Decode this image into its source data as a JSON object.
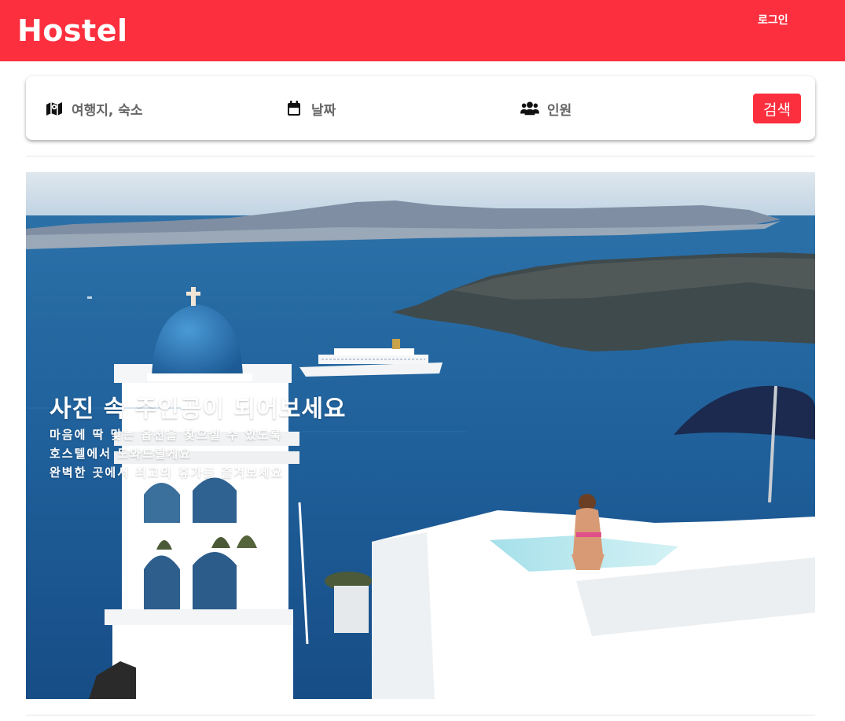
{
  "header": {
    "logo": "Hostel",
    "login_label": "로그인"
  },
  "search": {
    "destination": {
      "label": "여행지, 숙소",
      "icon": "map-icon"
    },
    "date": {
      "label": "날짜",
      "icon": "calendar-icon"
    },
    "guests": {
      "label": "인원",
      "icon": "users-icon"
    },
    "button_label": "검색"
  },
  "hero": {
    "title": "사진 속 주인공이 되어보세요",
    "lines": [
      "마음에 딱 맞는 옵션을 찾으실 수 있도록",
      "호스텔에서 도와드릴게요",
      "완벽한 곳에서 최고의 휴가를 즐겨보세요"
    ]
  },
  "colors": {
    "accent": "#fc2f3e",
    "text_muted": "#666666",
    "sea": "#1f5f9a",
    "dome": "#2a6fb0"
  }
}
